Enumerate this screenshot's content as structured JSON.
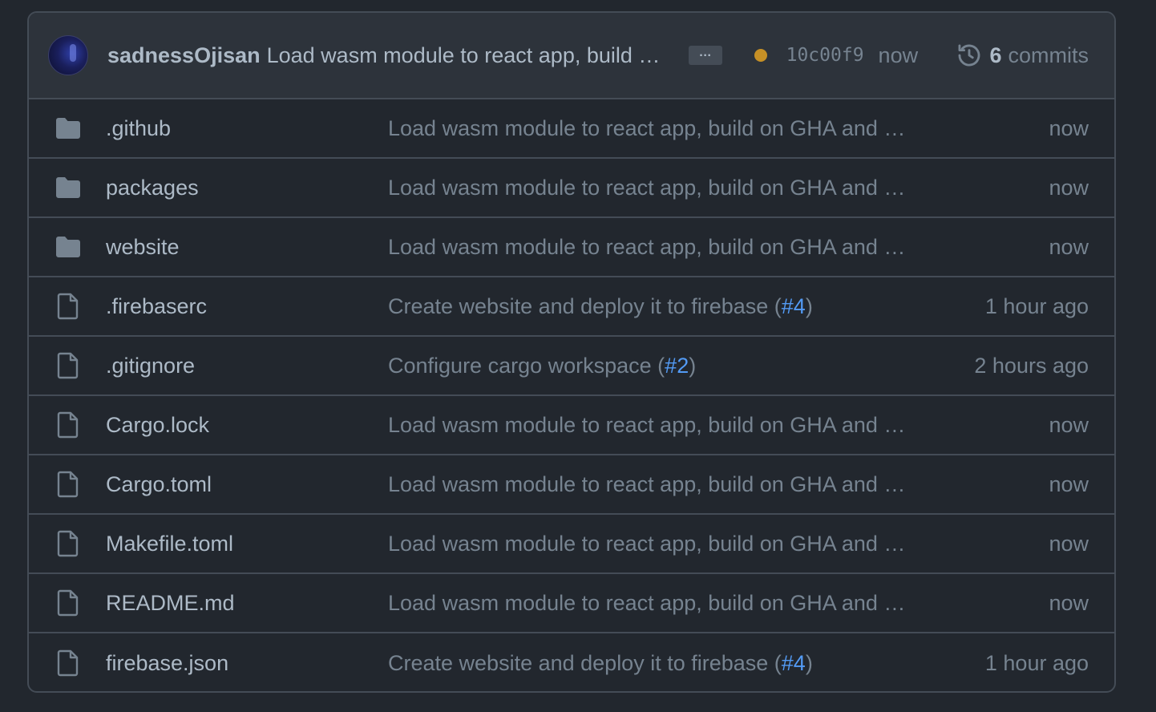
{
  "latest_commit": {
    "author": "sadnessOjisan",
    "message": "Load wasm module to react app, build on GHA and deploy to firebase",
    "ellipsis": "…",
    "status_color": "#c69026",
    "sha": "10c00f9",
    "time": "now",
    "commit_count": "6",
    "commits_label": "commits"
  },
  "files": [
    {
      "type": "folder",
      "icon": "folder-icon",
      "name": ".github",
      "message": "Load wasm module to react app, build on GHA and deploy to firebase",
      "pr": "",
      "time": "now"
    },
    {
      "type": "folder",
      "icon": "folder-icon",
      "name": "packages",
      "message": "Load wasm module to react app, build on GHA and deploy to firebase",
      "pr": "",
      "time": "now"
    },
    {
      "type": "folder",
      "icon": "folder-icon",
      "name": "website",
      "message": "Load wasm module to react app, build on GHA and deploy to firebase",
      "pr": "",
      "time": "now"
    },
    {
      "type": "file",
      "icon": "file-icon",
      "name": ".firebaserc",
      "message": "Create website and deploy it to firebase (",
      "pr": "#4",
      "time": "1 hour ago"
    },
    {
      "type": "file",
      "icon": "file-icon",
      "name": ".gitignore",
      "message": "Configure cargo workspace (",
      "pr": "#2",
      "time": "2 hours ago"
    },
    {
      "type": "file",
      "icon": "file-icon",
      "name": "Cargo.lock",
      "message": "Load wasm module to react app, build on GHA and deploy to firebase",
      "pr": "",
      "time": "now"
    },
    {
      "type": "file",
      "icon": "file-icon",
      "name": "Cargo.toml",
      "message": "Load wasm module to react app, build on GHA and deploy to firebase",
      "pr": "",
      "time": "now"
    },
    {
      "type": "file",
      "icon": "file-icon",
      "name": "Makefile.toml",
      "message": "Load wasm module to react app, build on GHA and deploy to firebase",
      "pr": "",
      "time": "now"
    },
    {
      "type": "file",
      "icon": "file-icon",
      "name": "README.md",
      "message": "Load wasm module to react app, build on GHA and deploy to firebase",
      "pr": "",
      "time": "now"
    },
    {
      "type": "file",
      "icon": "file-icon",
      "name": "firebase.json",
      "message": "Create website and deploy it to firebase (",
      "pr": "#4",
      "time": "1 hour ago"
    }
  ]
}
